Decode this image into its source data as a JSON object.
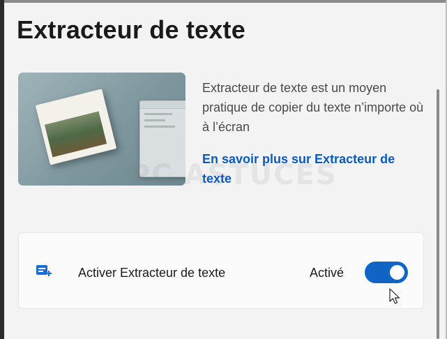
{
  "page": {
    "title": "Extracteur de texte"
  },
  "about": {
    "description": "Extracteur de texte est un moyen pratique de copier du texte n’importe où à l’écran",
    "learn_more_link": "En savoir plus sur Extracteur de texte"
  },
  "setting": {
    "icon": "text-extractor-icon",
    "label": "Activer Extracteur de texte",
    "state_label": "Activé",
    "toggle_on": true
  },
  "watermark": "PC ASTUCES",
  "colors": {
    "accent": "#0f64c6",
    "link": "#0b5ab8",
    "background": "#f3f3f3",
    "card": "#fbfbfb"
  }
}
